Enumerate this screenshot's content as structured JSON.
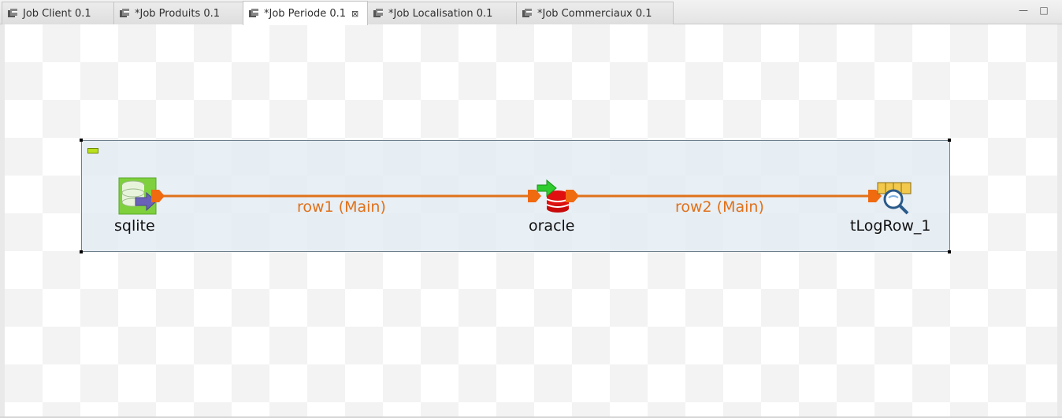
{
  "tabs": [
    {
      "label": "Job Client 0.1",
      "active": false
    },
    {
      "label": "*Job Produits 0.1",
      "active": false
    },
    {
      "label": "*Job Periode 0.1",
      "active": true
    },
    {
      "label": "*Job Localisation 0.1",
      "active": false
    },
    {
      "label": "*Job Commerciaux 0.1",
      "active": false
    }
  ],
  "window_controls": {
    "minimize": "—",
    "maximize": "□"
  },
  "tab_close": "⊠",
  "components": {
    "sqlite": {
      "label": "sqlite",
      "icon": "sqlite-input-icon"
    },
    "oracle": {
      "label": "oracle",
      "icon": "oracle-output-icon"
    },
    "tlogrow": {
      "label": "tLogRow_1",
      "icon": "logrow-icon"
    }
  },
  "links": {
    "row1": {
      "label": "row1 (Main)"
    },
    "row2": {
      "label": "row2 (Main)"
    }
  },
  "colors": {
    "link": "#e0711a",
    "subjob_border": "#6e7f8c",
    "subjob_fill": "#e1ebf2",
    "collapse": "#b9e01c"
  }
}
